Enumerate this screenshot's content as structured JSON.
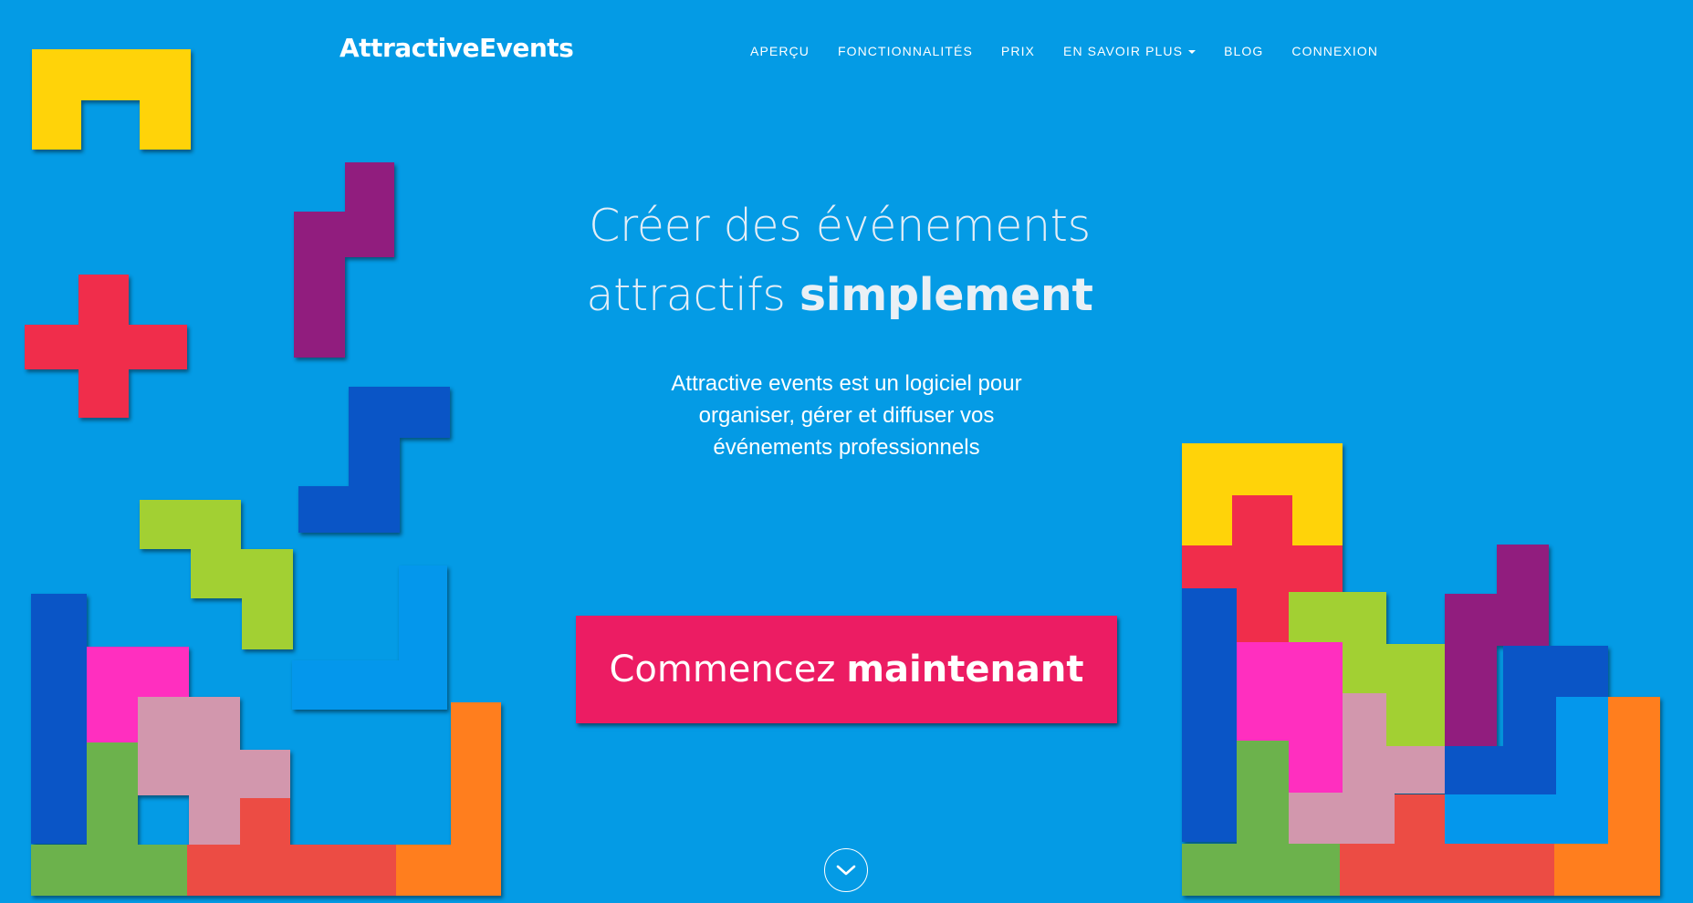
{
  "header": {
    "brand": "AttractiveEvents",
    "nav": [
      {
        "label": "APERÇU"
      },
      {
        "label": "FONCTIONNALITÉS"
      },
      {
        "label": "PRIX"
      },
      {
        "label": "EN SAVOIR PLUS",
        "dropdown": true
      },
      {
        "label": "BLOG"
      },
      {
        "label": "CONNEXION"
      }
    ]
  },
  "hero": {
    "title_line1": "Créer des événements",
    "title_line2_light": "attractifs",
    "title_line2_bold": "simplement",
    "subtitle": "Attractive events est un logiciel pour organiser, gérer et diffuser vos événements professionnels",
    "cta_light": "Commencez",
    "cta_bold": "maintenant",
    "scroll_icon": "chevron-down-icon"
  },
  "colors": {
    "background": "#049be5",
    "cta": "#ec1c63",
    "yellow": "#ffd309",
    "red": "#f02d4b",
    "purple": "#911d7e",
    "dark-blue": "#0a55c6",
    "light-green": "#a2d033",
    "bright-blue": "#0497ec",
    "magenta": "#ff2fbf",
    "pink": "#d297ad",
    "green": "#6cb24c",
    "coral": "#ec4c44",
    "orange": "#ff7e1e"
  },
  "decorations": [
    "tetris-blocks-left",
    "tetris-blocks-right"
  ]
}
